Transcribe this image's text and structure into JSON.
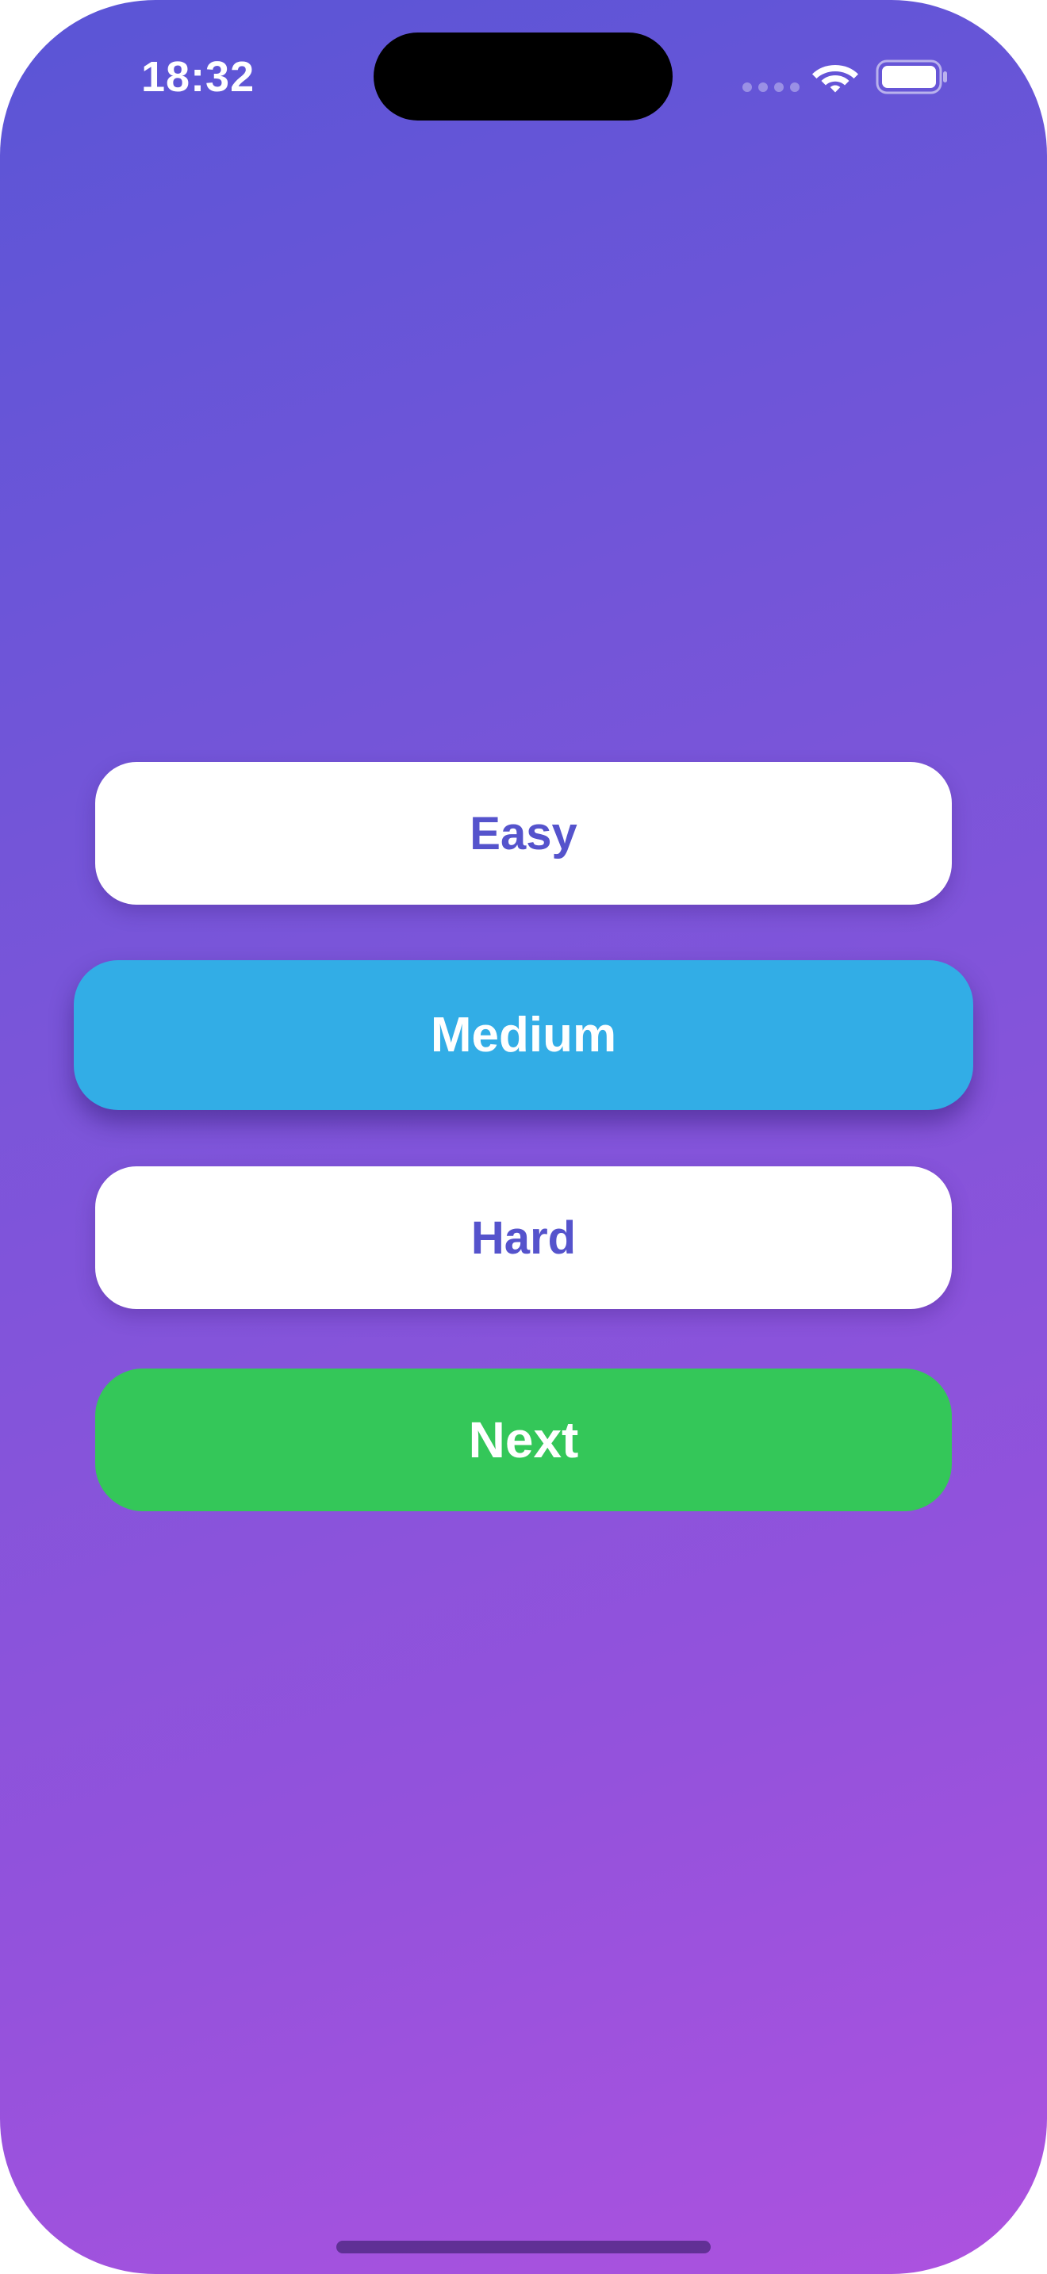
{
  "status_bar": {
    "time": "18:32",
    "wifi_icon": "wifi-icon",
    "battery_icon": "battery-icon"
  },
  "difficulty": {
    "options": [
      {
        "label": "Easy",
        "selected": false
      },
      {
        "label": "Medium",
        "selected": true
      },
      {
        "label": "Hard",
        "selected": false
      }
    ]
  },
  "actions": {
    "next_label": "Next"
  },
  "colors": {
    "background_start": "#5a55d6",
    "background_end": "#ad52df",
    "selected_option": "#32ade6",
    "unselected_option": "#ffffff",
    "option_text": "#5553cc",
    "next_button": "#34c759"
  }
}
